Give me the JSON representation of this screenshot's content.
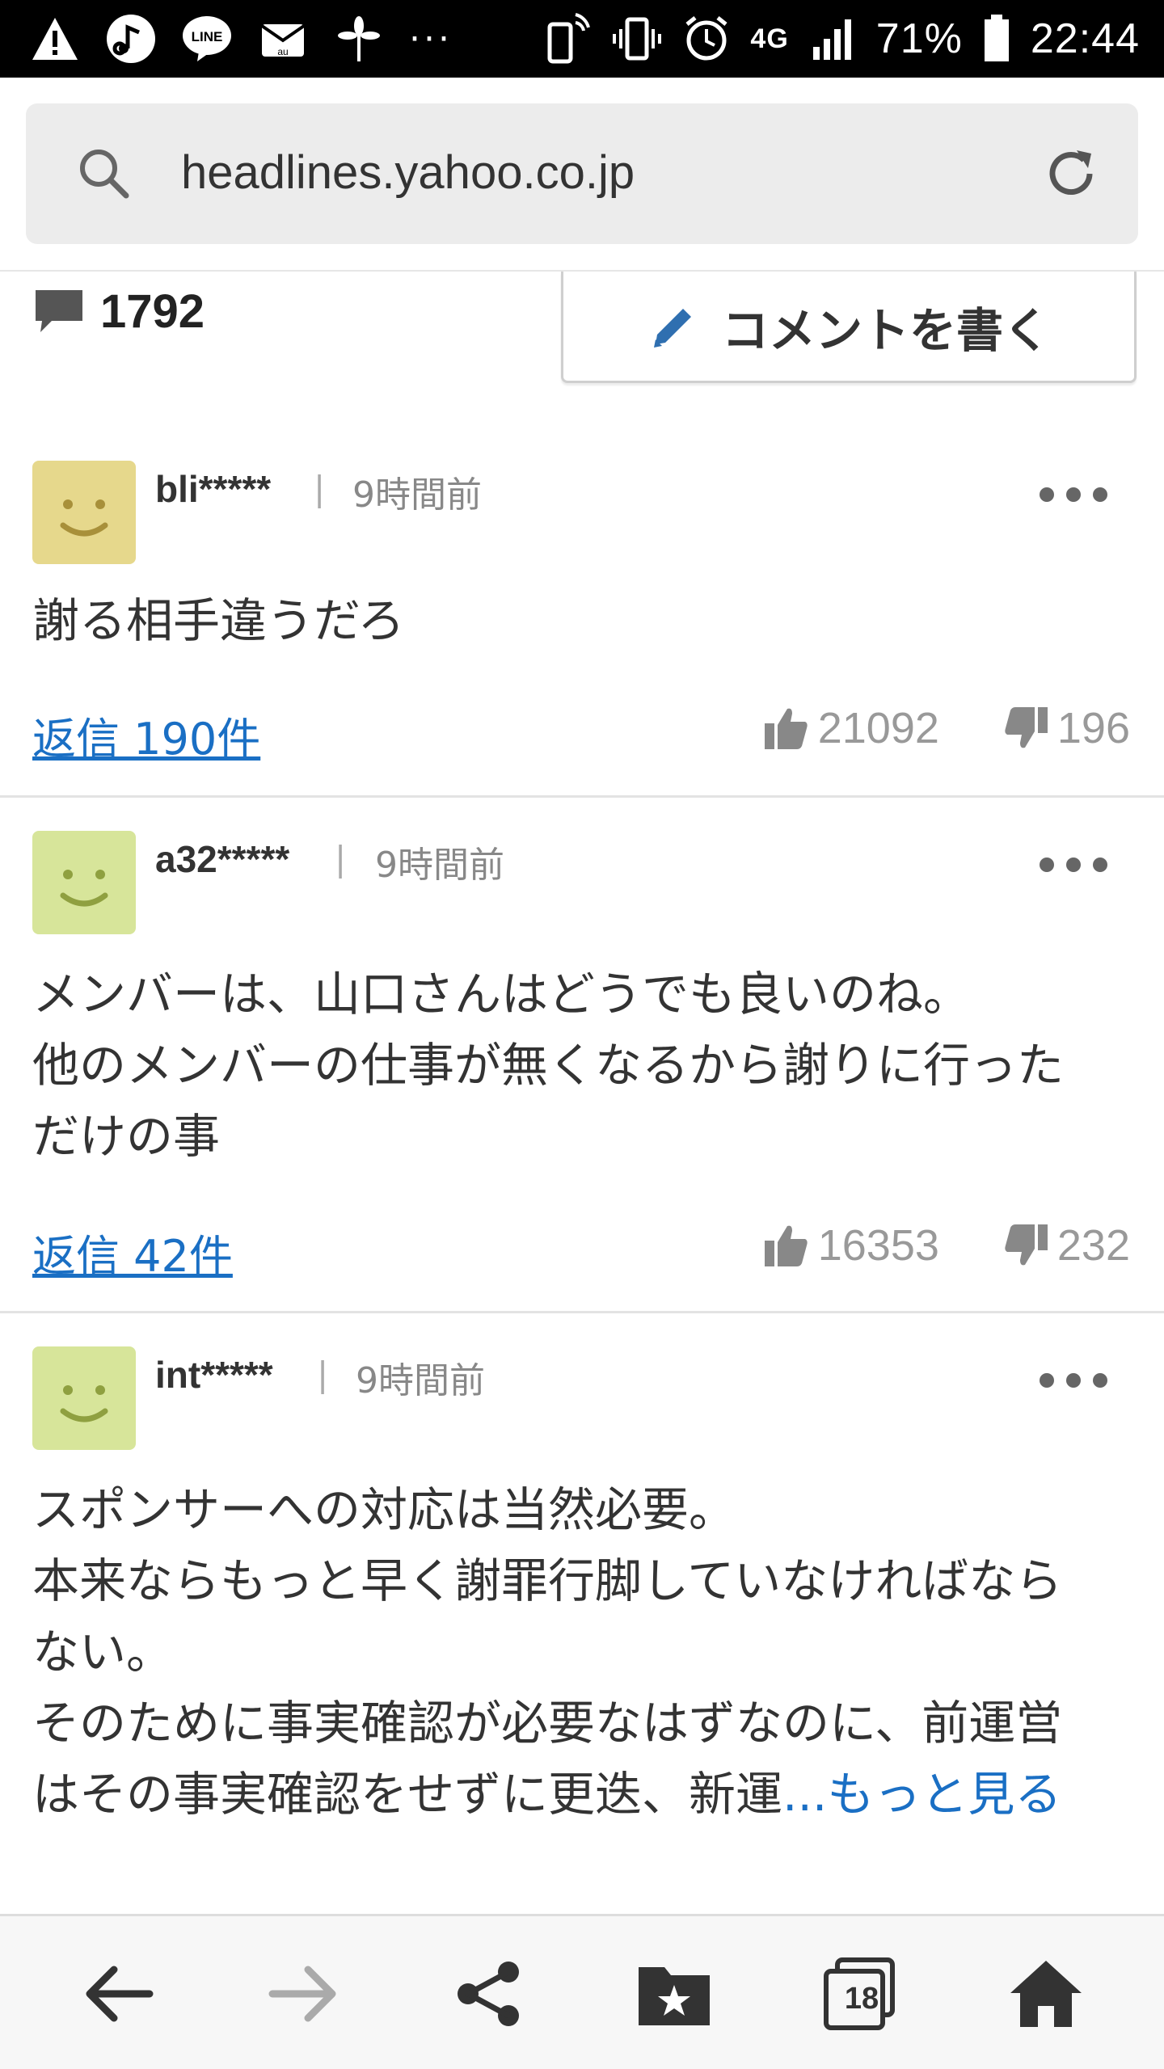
{
  "status_bar": {
    "battery": "71%",
    "time": "22:44",
    "network": "4G",
    "overflow": "···",
    "icons": [
      "warning-icon",
      "music-icon",
      "line-icon",
      "mail-icon",
      "pinwheel-icon",
      "phone-signal-icon",
      "vibrate-icon",
      "alarm-icon",
      "cell-signal-icon",
      "battery-icon"
    ]
  },
  "browser": {
    "url": "headlines.yahoo.co.jp"
  },
  "comments_header": {
    "count": "1792",
    "write_label": "コメントを書く"
  },
  "comments": [
    {
      "user": "bli*****",
      "separator": "|",
      "time": "9時間前",
      "avatar_color": "#e6d88c",
      "text": "謝る相手違うだろ",
      "replies": "返信 190件",
      "likes": "21092",
      "dislikes": "196"
    },
    {
      "user": "a32*****",
      "separator": "|",
      "time": "9時間前",
      "avatar_color": "#d7e59a",
      "text": "メンバーは、山口さんはどうでも良いのね。\n他のメンバーの仕事が無くなるから謝りに行った\nだけの事",
      "replies": "返信 42件",
      "likes": "16353",
      "dislikes": "232"
    },
    {
      "user": "int*****",
      "separator": "|",
      "time": "9時間前",
      "avatar_color": "#d7e59a",
      "text": "スポンサーへの対応は当然必要。\n本来ならもっと早く謝罪行脚していなければなら\nない。\nそのために事実確認が必要なはずなのに、前運営\nはその事実確認をせずに更迭、新運",
      "read_more": "...もっと見る"
    }
  ],
  "bottom_nav": {
    "tab_count": "18",
    "accent": "#1a6fc4"
  }
}
